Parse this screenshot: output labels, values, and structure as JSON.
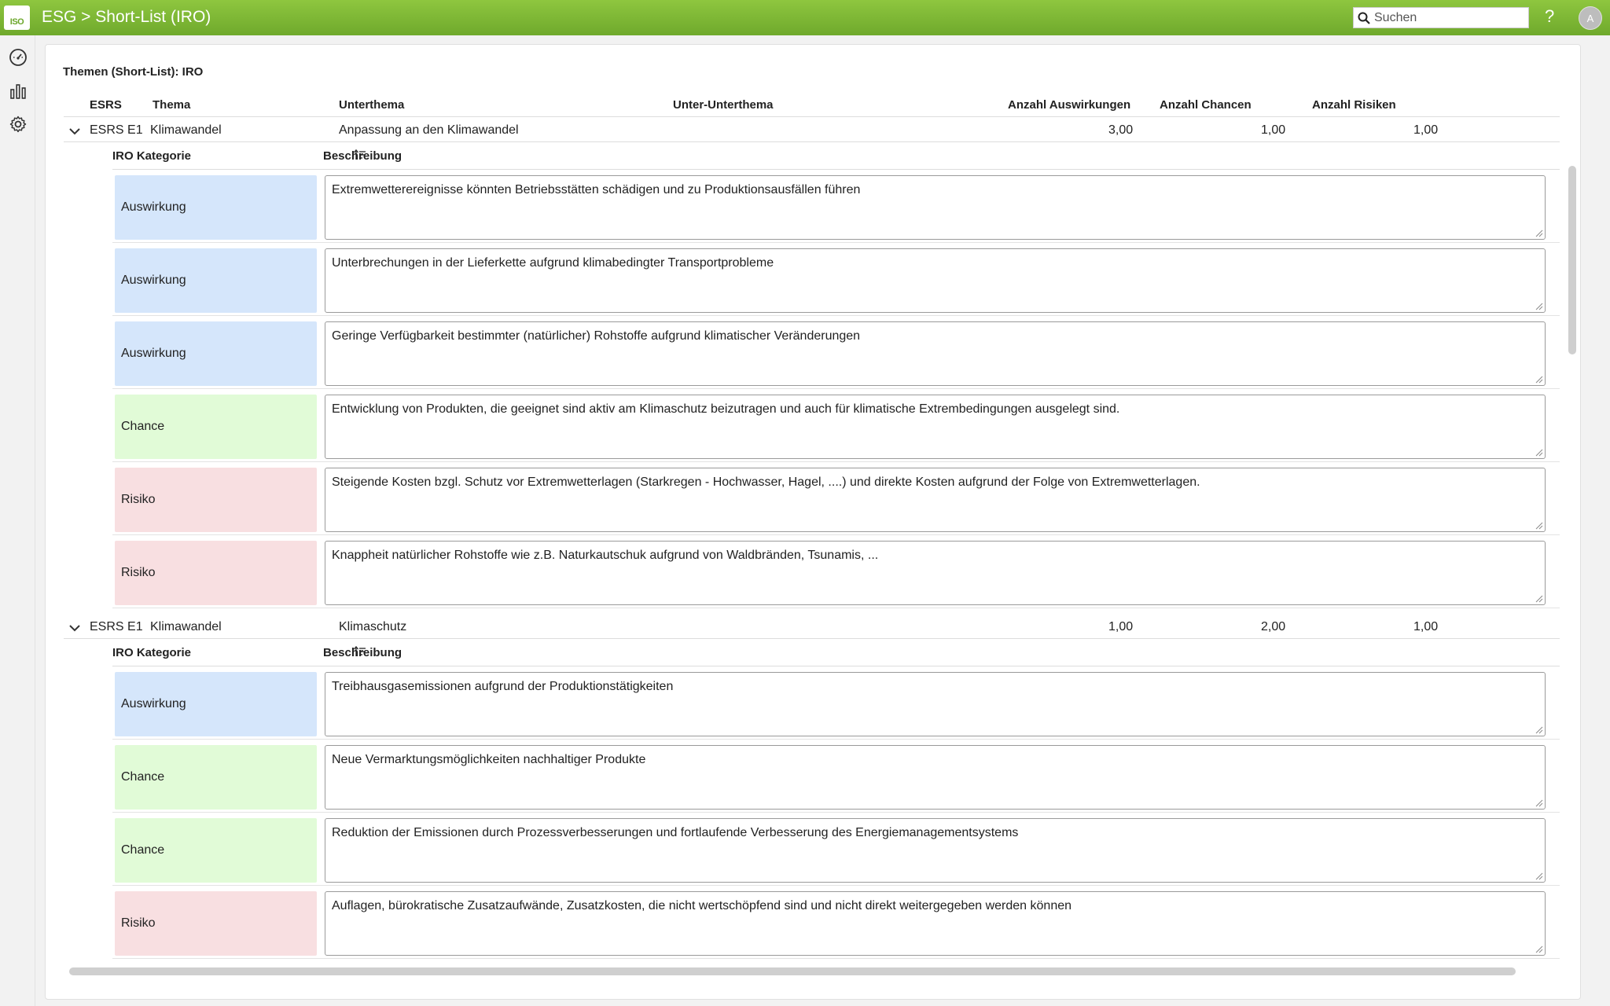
{
  "app": {
    "logo_text": "ISO",
    "title": "ESG > Short-List (IRO)"
  },
  "search": {
    "placeholder": "Suchen"
  },
  "help_label": "?",
  "avatar_initial": "A",
  "rail": [
    "dashboard-icon",
    "chart-icon",
    "settings-icon"
  ],
  "panel_title": "Themen (Short-List): IRO",
  "columns": {
    "esrs": "ESRS",
    "thema": "Thema",
    "unterthema": "Unterthema",
    "unter_unterthema": "Unter-Unterthema",
    "auswirkungen": "Anzahl Auswirkungen",
    "chancen": "Anzahl Chancen",
    "risiken": "Anzahl Risiken"
  },
  "sub_columns": {
    "kategorie": "IRO Kategorie",
    "beschreibung": "Beschreibung"
  },
  "colors": {
    "auswirkung": "#d5e6fb",
    "chance": "#e1fbd7",
    "risiko": "#f8dfe1",
    "brand": "#7cb733"
  },
  "groups": [
    {
      "esrs": "ESRS E1",
      "thema": "Klimawandel",
      "unterthema": "Anpassung an den Klimawandel",
      "unter_unterthema": "",
      "auswirkungen": "3,00",
      "chancen": "1,00",
      "risiken": "1,00",
      "items": [
        {
          "kategorie": "Auswirkung",
          "type": "a",
          "text": "Extremwetterereignisse könnten Betriebsstätten schädigen und zu Produktionsausfällen führen"
        },
        {
          "kategorie": "Auswirkung",
          "type": "a",
          "text": "Unterbrechungen in der Lieferkette aufgrund klimabedingter Transportprobleme"
        },
        {
          "kategorie": "Auswirkung",
          "type": "a",
          "text": "Geringe Verfügbarkeit bestimmter (natürlicher) Rohstoffe aufgrund klimatischer Veränderungen"
        },
        {
          "kategorie": "Chance",
          "type": "c",
          "text": "Entwicklung von Produkten, die geeignet sind aktiv am Klimaschutz beizutragen und auch für klimatische Extrembedingungen ausgelegt sind."
        },
        {
          "kategorie": "Risiko",
          "type": "r",
          "text": "Steigende Kosten bzgl. Schutz vor Extremwetterlagen (Starkregen - Hochwasser, Hagel, ....) und direkte Kosten aufgrund der Folge von Extremwetterlagen."
        },
        {
          "kategorie": "Risiko",
          "type": "r",
          "text": "Knappheit natürlicher Rohstoffe wie z.B. Naturkautschuk aufgrund von Waldbränden, Tsunamis, ..."
        }
      ]
    },
    {
      "esrs": "ESRS E1",
      "thema": "Klimawandel",
      "unterthema": "Klimaschutz",
      "unter_unterthema": "",
      "auswirkungen": "1,00",
      "chancen": "2,00",
      "risiken": "1,00",
      "items": [
        {
          "kategorie": "Auswirkung",
          "type": "a",
          "text": "Treibhausgasemissionen aufgrund der Produktionstätigkeiten"
        },
        {
          "kategorie": "Chance",
          "type": "c",
          "text": "Neue Vermarktungsmöglichkeiten nachhaltiger Produkte"
        },
        {
          "kategorie": "Chance",
          "type": "c",
          "text": "Reduktion der Emissionen durch Prozessverbesserungen und fortlaufende Verbesserung des Energiemanagementsystems"
        },
        {
          "kategorie": "Risiko",
          "type": "r",
          "text": "Auflagen, bürokratische Zusatzaufwände, Zusatzkosten, die nicht wertschöpfend sind und nicht direkt weitergegeben werden können"
        }
      ]
    }
  ]
}
